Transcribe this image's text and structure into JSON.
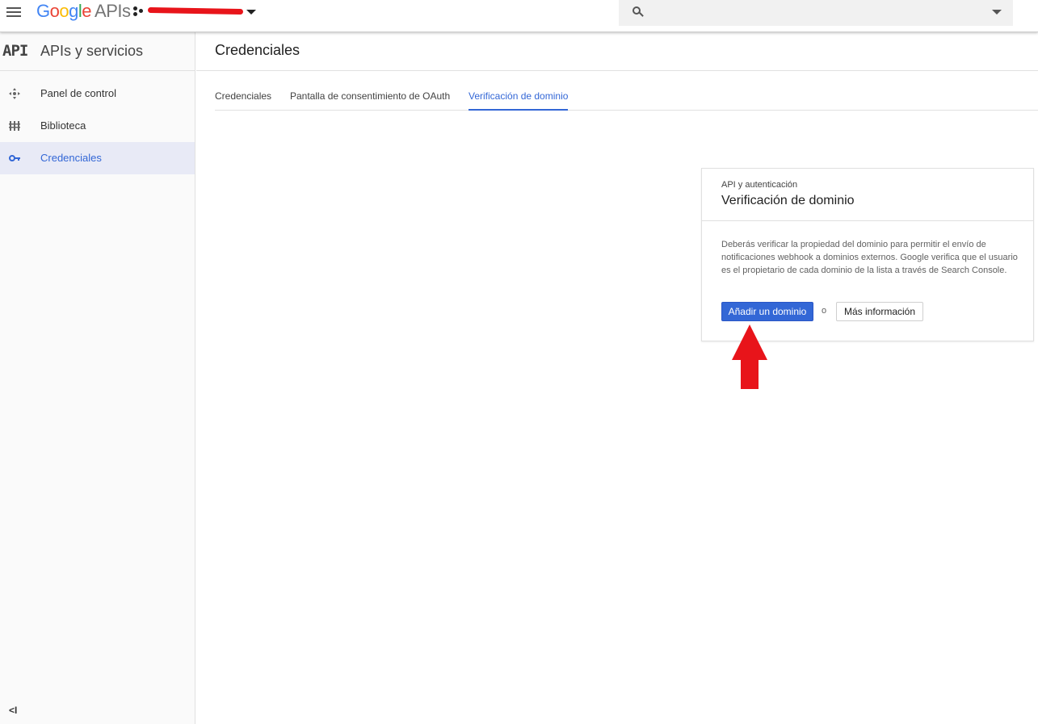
{
  "topbar": {
    "logo_letters": [
      "G",
      "o",
      "o",
      "g",
      "l",
      "e"
    ],
    "logo_suffix": "APIs",
    "search_placeholder": "",
    "icons": [
      "menu-icon",
      "project-icon",
      "search-icon",
      "chevron-down-icon"
    ]
  },
  "sidebar": {
    "api_badge": "API",
    "title": "APIs y servicios",
    "items": [
      {
        "label": "Panel de control",
        "icon": "dashboard-icon"
      },
      {
        "label": "Biblioteca",
        "icon": "library-icon"
      },
      {
        "label": "Credenciales",
        "icon": "key-icon",
        "active": true
      }
    ],
    "collapse_glyph": "<I"
  },
  "main": {
    "title": "Credenciales",
    "tabs": [
      {
        "label": "Credenciales"
      },
      {
        "label": "Pantalla de consentimiento de OAuth"
      },
      {
        "label": "Verificación de dominio",
        "active": true
      }
    ]
  },
  "card": {
    "kicker": "API y autenticación",
    "title": "Verificación de dominio",
    "body": "Deberás verificar la propiedad del dominio para permitir el envío de notificaciones webhook a dominios externos. Google verifica que el usuario es el propietario de cada dominio de la lista a través de Search Console.",
    "primary_button": "Añadir un dominio",
    "or_text": "o",
    "secondary_button": "Más información"
  },
  "colors": {
    "accent": "#3367d6",
    "annotation_arrow": "#e8141a",
    "redaction": "#e8141a"
  }
}
